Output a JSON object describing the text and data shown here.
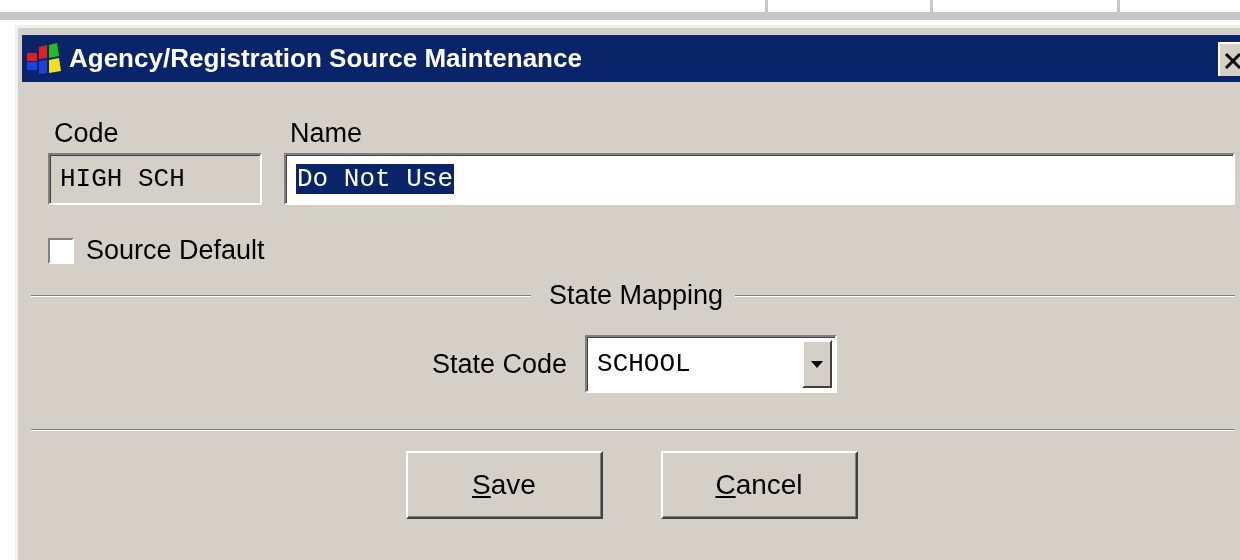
{
  "window": {
    "title": "Agency/Registration Source Maintenance"
  },
  "code": {
    "label": "Code",
    "value": "HIGH SCH",
    "disabled": true
  },
  "name": {
    "label": "Name",
    "value": "Do Not Use",
    "selected": true
  },
  "source_default": {
    "label": "Source Default",
    "checked": false
  },
  "state_mapping": {
    "legend": "State Mapping",
    "state_code": {
      "label": "State Code",
      "value": "SCHOOL"
    }
  },
  "buttons": [
    {
      "label": "Save",
      "underline_first": true
    },
    {
      "label": "Cancel",
      "underline_first": true
    }
  ]
}
